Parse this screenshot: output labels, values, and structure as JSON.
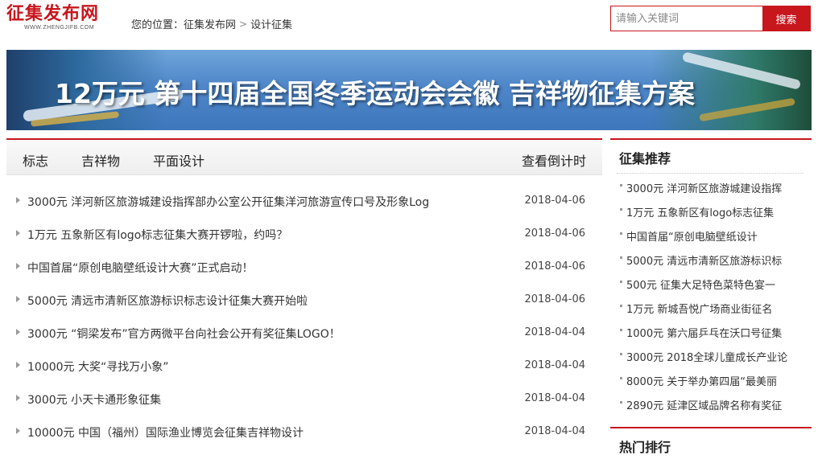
{
  "logo": {
    "text": "征集发布网",
    "url_text": "WWW.ZHENGJIFB.COM"
  },
  "breadcrumb": {
    "label": "您的位置：",
    "home": "征集发布网",
    "separator": ">",
    "current": "设计征集"
  },
  "search": {
    "placeholder": "请输入关键词",
    "button_label": "搜索"
  },
  "banner": {
    "title": "12万元 第十四届全国冬季运动会会徽 吉祥物征集方案"
  },
  "tabs": {
    "items": [
      {
        "label": "标志"
      },
      {
        "label": "吉祥物"
      },
      {
        "label": "平面设计"
      }
    ],
    "countdown_label": "查看倒计时"
  },
  "news": [
    {
      "title": "3000元 洋河新区旅游城建设指挥部办公室公开征集洋河旅游宣传口号及形象Log",
      "date": "2018-04-06"
    },
    {
      "title": "1万元 五象新区有logo标志征集大赛开锣啦，约吗？",
      "date": "2018-04-06"
    },
    {
      "title": "中国首届“原创电脑壁纸设计大赛”正式启动！",
      "date": "2018-04-06"
    },
    {
      "title": "5000元 清远市清新区旅游标识标志设计征集大赛开始啦",
      "date": "2018-04-06"
    },
    {
      "title": "3000元 “铜梁发布”官方两微平台向社会公开有奖征集LOGO！",
      "date": "2018-04-04"
    },
    {
      "title": "10000元 大奖“寻找万小象”",
      "date": "2018-04-04"
    },
    {
      "title": "3000元 小天卡通形象征集",
      "date": "2018-04-04"
    },
    {
      "title": "10000元 中国（福州）国际渔业博览会征集吉祥物设计",
      "date": "2018-04-04"
    }
  ],
  "sidebar": {
    "title": "征集推荐",
    "items": [
      {
        "text": "3000元 洋河新区旅游城建设指挥"
      },
      {
        "text": "1万元 五象新区有logo标志征集"
      },
      {
        "text": "中国首届“原创电脑壁纸设计"
      },
      {
        "text": "5000元 清远市清新区旅游标识标"
      },
      {
        "text": "500元 征集大足特色菜特色宴一"
      },
      {
        "text": "1万元 新城吾悦广场商业街征名"
      },
      {
        "text": "1000元 第六届乒乓在沃口号征集"
      },
      {
        "text": "3000元 2018全球儿童成长产业论"
      },
      {
        "text": "8000元 关于举办第四届“最美丽"
      },
      {
        "text": "2890元 延津区域品牌名称有奖征"
      }
    ],
    "section2_title": "热门排行"
  },
  "colors": {
    "accent": "#c8161d",
    "banner_blue": "#4e86c8"
  }
}
